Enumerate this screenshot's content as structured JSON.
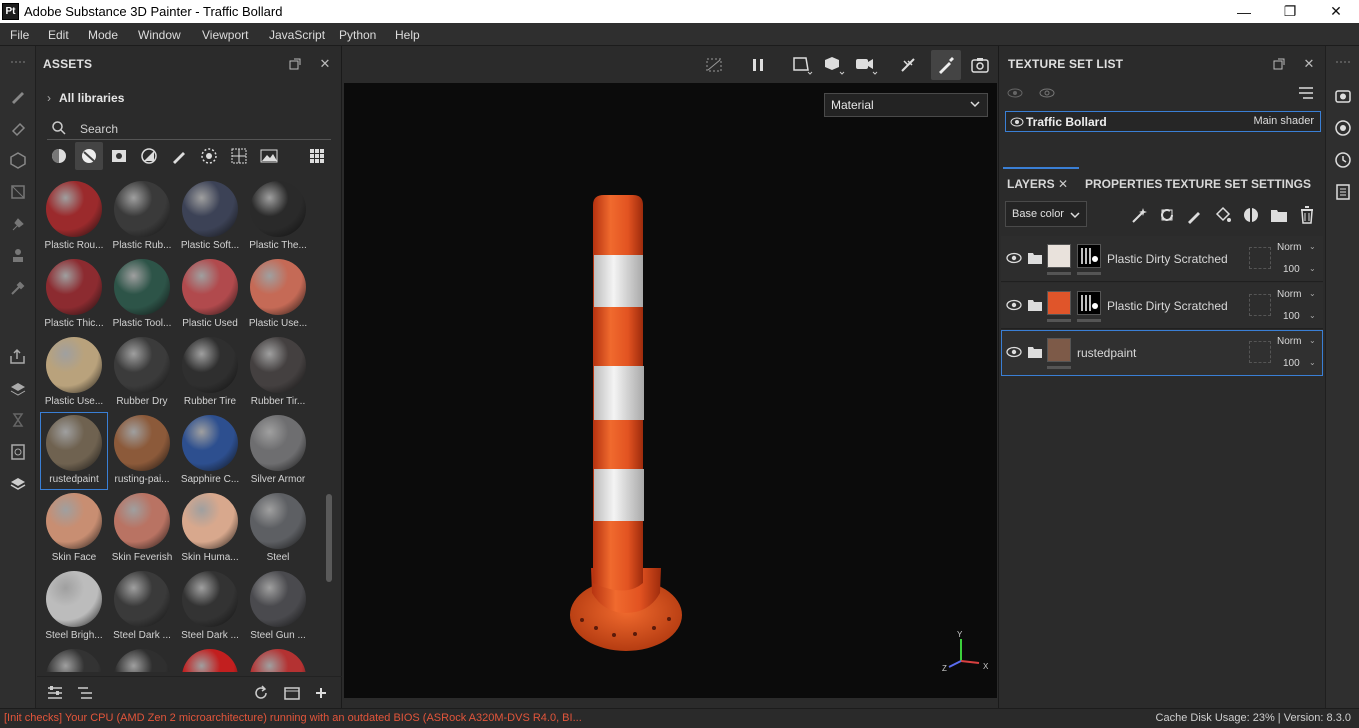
{
  "window": {
    "app_logo": "Pt",
    "title": "Adobe Substance 3D Painter - Traffic Bollard",
    "controls": [
      "minimize-icon",
      "maximize-icon",
      "close-icon"
    ]
  },
  "menu": [
    "File",
    "Edit",
    "Mode",
    "Window",
    "Viewport",
    "JavaScript",
    "Python",
    "Help"
  ],
  "left_toolbar": [
    "paint-brush-icon",
    "eraser-icon",
    "projection-icon",
    "polygon-fill-icon",
    "smudge-icon",
    "clone-stamp-icon",
    "color-picker-icon",
    "export-icon",
    "bake-icon",
    "history-icon",
    "display-settings-icon",
    "shader-settings-icon"
  ],
  "assets": {
    "title": "ASSETS",
    "library": "All libraries",
    "search_placeholder": "Search",
    "filters": [
      "materials-icon",
      "smart-materials-icon",
      "textures-icon",
      "masks-icon",
      "brushes-icon",
      "alphas-icon",
      "procedurals-icon",
      "environments-icon",
      "grid-view-icon"
    ],
    "items": [
      {
        "label": "Plastic Rou...",
        "color": "#9b2a2c"
      },
      {
        "label": "Plastic Rub...",
        "color": "#3a3a3a"
      },
      {
        "label": "Plastic Soft...",
        "color": "#3c4256"
      },
      {
        "label": "Plastic The...",
        "color": "#2a2a2a"
      },
      {
        "label": "Plastic Thic...",
        "color": "#8c2b30"
      },
      {
        "label": "Plastic Tool...",
        "color": "#2d5448"
      },
      {
        "label": "Plastic Used",
        "color": "#b14a4d"
      },
      {
        "label": "Plastic Use...",
        "color": "#c56a56"
      },
      {
        "label": "Plastic Use...",
        "color": "#b9a27c"
      },
      {
        "label": "Rubber Dry",
        "color": "#3b3b3b"
      },
      {
        "label": "Rubber Tire",
        "color": "#2f2f2f"
      },
      {
        "label": "Rubber Tir...",
        "color": "#444040"
      },
      {
        "label": "rustedpaint",
        "color": "#6f6250"
      },
      {
        "label": "rusting-pai...",
        "color": "#8c5a3a"
      },
      {
        "label": "Sapphire C...",
        "color": "#2d4f8f"
      },
      {
        "label": "Silver Armor",
        "color": "#6e6e70"
      },
      {
        "label": "Skin Face",
        "color": "#c88e72"
      },
      {
        "label": "Skin Feverish",
        "color": "#b97363"
      },
      {
        "label": "Skin Huma...",
        "color": "#d8a88d"
      },
      {
        "label": "Steel",
        "color": "#5d5f63"
      },
      {
        "label": "Steel Brigh...",
        "color": "#bcbcbc"
      },
      {
        "label": "Steel Dark ...",
        "color": "#3a3a3a"
      },
      {
        "label": "Steel Dark ...",
        "color": "#333"
      },
      {
        "label": "Steel Gun ...",
        "color": "#4a4a4e"
      },
      {
        "label": "",
        "color": "#333"
      },
      {
        "label": "",
        "color": "#2f2f2f"
      },
      {
        "label": "",
        "color": "#c21f1f"
      },
      {
        "label": "",
        "color": "#b43232"
      }
    ],
    "selected_index": 12,
    "footer_icons": [
      "filter-options-icon",
      "list-view-icon",
      "refresh-icon",
      "folder-icon",
      "add-icon"
    ]
  },
  "viewport": {
    "toolbar": [
      "hide-icon",
      "pause-icon",
      "camera-frame-icon",
      "cube-icon",
      "video-camera-icon",
      "symmetry-icon",
      "paint-icon",
      "screenshot-icon"
    ],
    "mode": "Material",
    "axis": {
      "y": "Y",
      "x": "X",
      "z": "Z"
    }
  },
  "texture_set_list": {
    "title": "TEXTURE SET LIST",
    "set_name": "Traffic Bollard",
    "shader": "Main shader"
  },
  "layers_panel": {
    "tabs": [
      "LAYERS",
      "PROPERTIES",
      "TEXTURE SET SETTINGS"
    ],
    "channel": "Base color",
    "tools": [
      "add-effect-icon",
      "add-mask-icon",
      "add-paint-layer-icon",
      "add-fill-layer-icon",
      "add-mask-with-icon",
      "add-folder-icon",
      "delete-icon"
    ],
    "layers": [
      {
        "name": "Plastic Dirty Scratched",
        "blend": "Norm",
        "opacity": "100",
        "thumb_color": "#e9e2dc",
        "has_mask": true
      },
      {
        "name": "Plastic Dirty Scratched",
        "blend": "Norm",
        "opacity": "100",
        "thumb_color": "#e0552a",
        "has_mask": true
      },
      {
        "name": "rustedpaint",
        "blend": "Norm",
        "opacity": "100",
        "thumb_color": "#7d5a48",
        "has_mask": false
      }
    ]
  },
  "right_toolbar": [
    "settings-icon",
    "lighting-icon",
    "history-icon",
    "log-icon"
  ],
  "status": {
    "message": "[Init checks] Your CPU (AMD Zen 2 microarchitecture) running with an outdated BIOS (ASRock A320M-DVS R4.0, BI...",
    "cache": "Cache Disk Usage:   23% | Version: 8.3.0"
  }
}
